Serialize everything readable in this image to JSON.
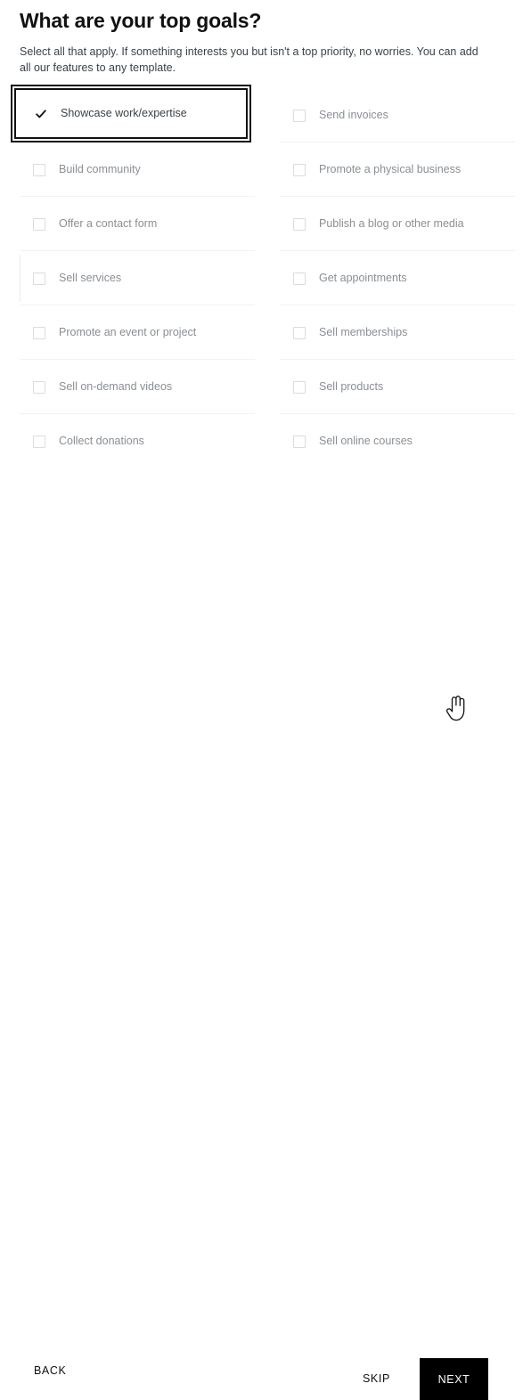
{
  "header": {
    "title": "What are your top goals?",
    "subtitle": "Select all that apply. If something interests you but isn't a top priority, no worries. You can add all our features to any template."
  },
  "goals": {
    "left_column": [
      {
        "label": "Showcase work/expertise",
        "checked": true
      },
      {
        "label": "Build community",
        "checked": false
      },
      {
        "label": "Offer a contact form",
        "checked": false
      },
      {
        "label": "Sell services",
        "checked": false
      },
      {
        "label": "Promote an event or project",
        "checked": false
      },
      {
        "label": "Sell on-demand videos",
        "checked": false
      },
      {
        "label": "Collect donations",
        "checked": false
      }
    ],
    "right_column": [
      {
        "label": "Send invoices",
        "checked": false
      },
      {
        "label": "Promote a physical business",
        "checked": false
      },
      {
        "label": "Publish a blog or other media",
        "checked": false
      },
      {
        "label": "Get appointments",
        "checked": false
      },
      {
        "label": "Sell memberships",
        "checked": false
      },
      {
        "label": "Sell products",
        "checked": false
      },
      {
        "label": "Sell online courses",
        "checked": false
      }
    ]
  },
  "footer": {
    "back_label": "BACK",
    "skip_label": "SKIP",
    "next_label": "NEXT"
  },
  "colors": {
    "text_primary": "#111111",
    "text_secondary": "#3a4248",
    "text_muted": "#8a8f94",
    "checkbox_border": "#dcdcdc",
    "divider": "#f2f2f2",
    "accent_button_bg": "#000000",
    "accent_button_text": "#ffffff",
    "focus_ring": "#111111"
  },
  "cursor": {
    "icon": "pointing-hand-cursor"
  }
}
